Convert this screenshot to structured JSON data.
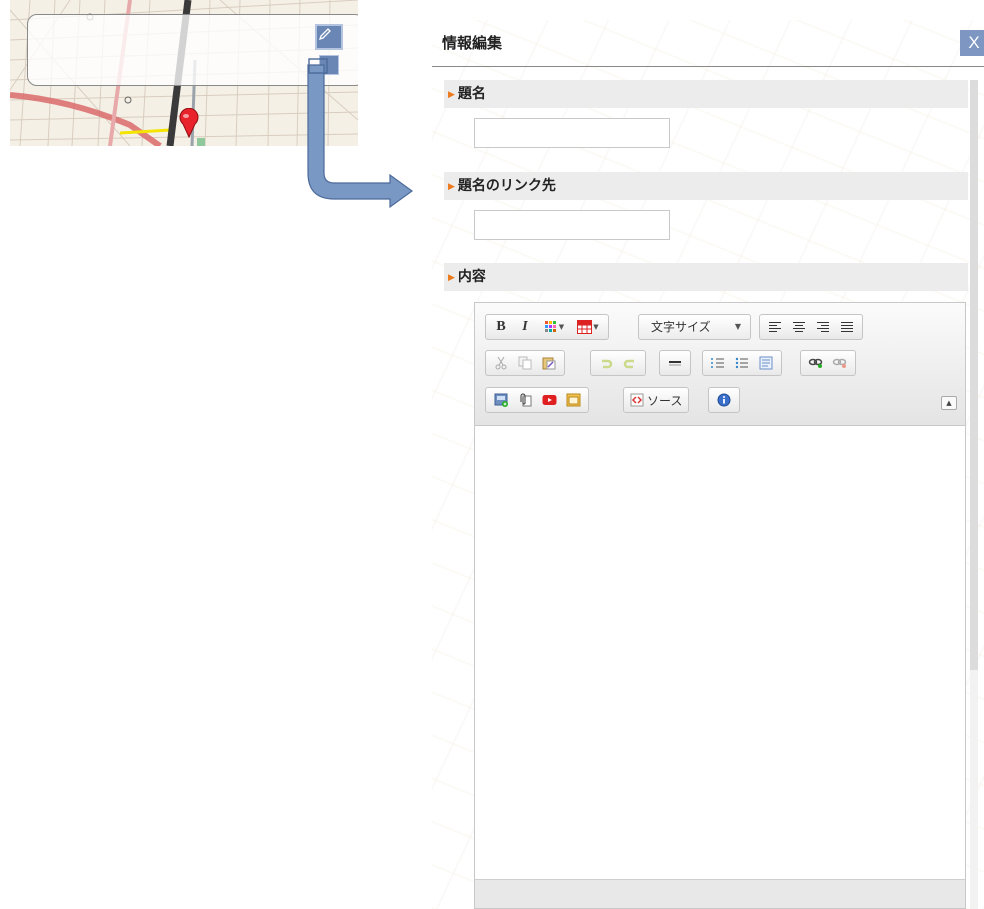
{
  "panel": {
    "title": "情報編集",
    "close_label": "X"
  },
  "sections": {
    "title": {
      "label": "題名",
      "value": ""
    },
    "link": {
      "label": "題名のリンク先",
      "value": ""
    },
    "content": {
      "label": "内容"
    }
  },
  "editor": {
    "font_size_label": "文字サイズ",
    "source_label": "ソース",
    "icons": {
      "row1": [
        "bold-icon",
        "italic-icon",
        "text-color-icon",
        "table-icon",
        "align-left-icon",
        "align-center-icon",
        "align-right-icon",
        "align-justify-icon"
      ],
      "row2": [
        "cut-icon",
        "copy-icon",
        "paste-icon",
        "undo-icon",
        "redo-icon",
        "horizontal-rule-icon",
        "numbered-list-icon",
        "bulleted-list-icon",
        "blockquote-icon",
        "link-icon",
        "unlink-icon"
      ],
      "row3": [
        "image-icon",
        "attach-file-icon",
        "youtube-icon",
        "iframe-icon",
        "source-icon",
        "about-icon"
      ]
    },
    "bold_glyph": "B",
    "italic_glyph": "I"
  },
  "map": {
    "icons": [
      "pencil-icon",
      "map-pin-icon"
    ],
    "colors": {
      "button": "#6a86b5",
      "pin": "#e8232b",
      "arrow": "#7a98c4"
    }
  }
}
